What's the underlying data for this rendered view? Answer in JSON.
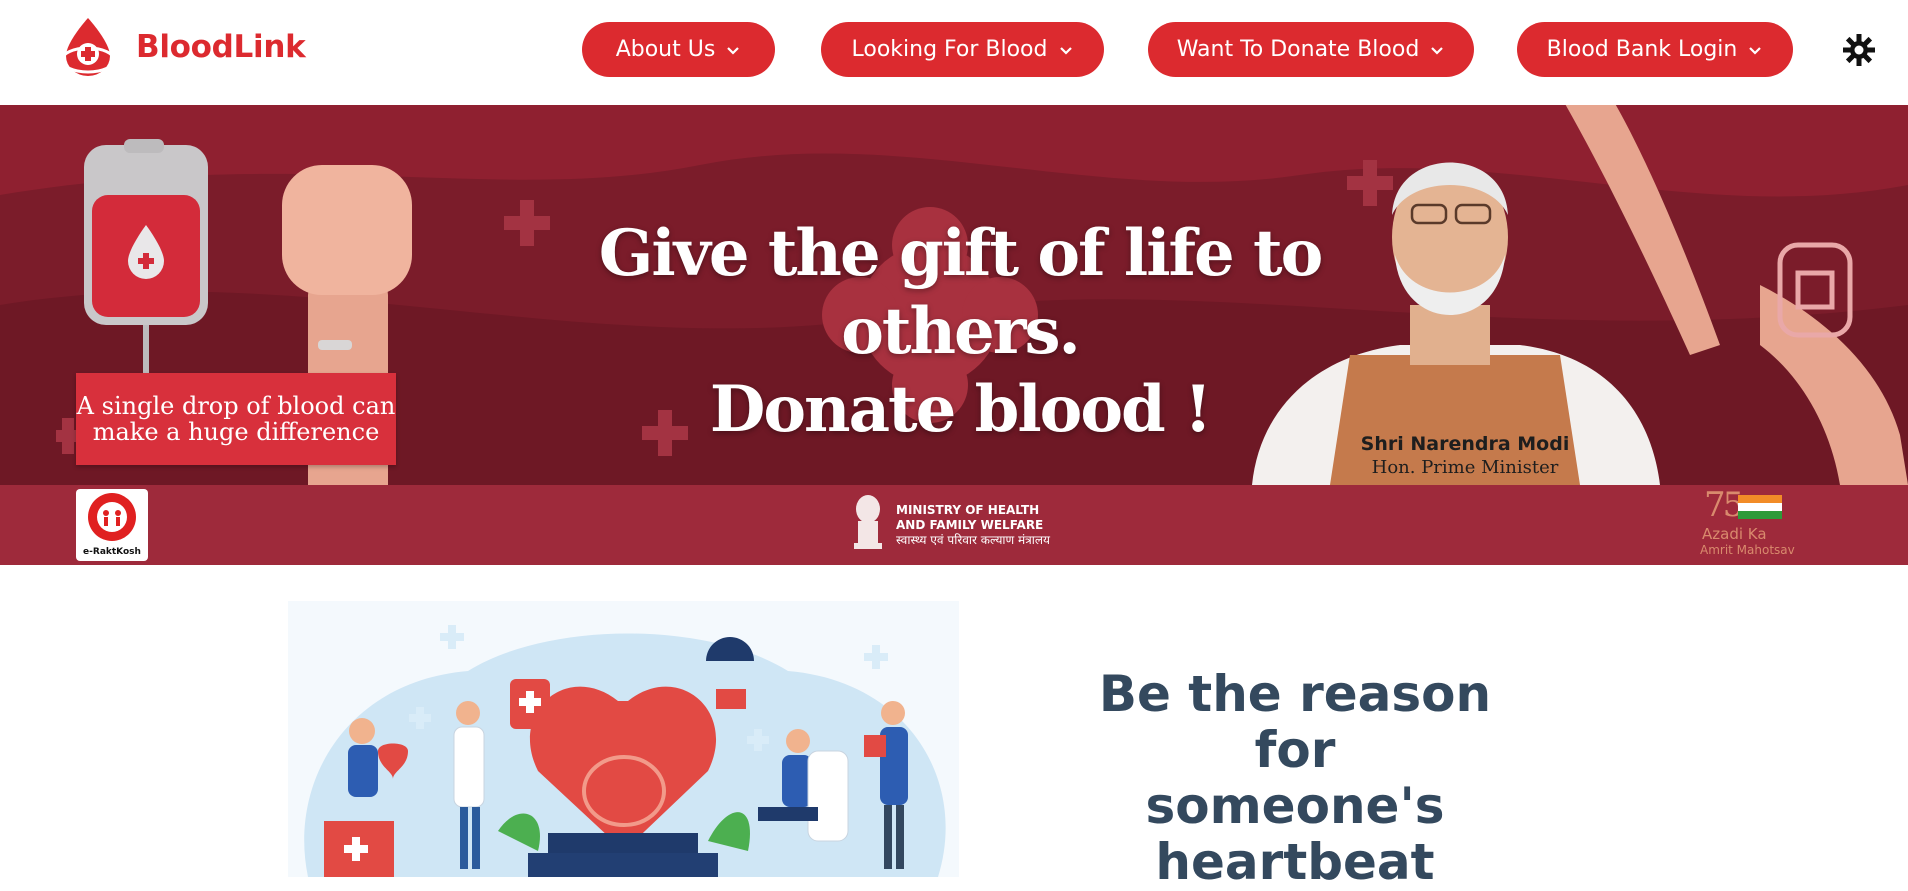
{
  "brand": {
    "name": "BloodLink",
    "color": "#dc2a2f"
  },
  "nav": {
    "items": [
      {
        "label": "About Us"
      },
      {
        "label": "Looking For Blood"
      },
      {
        "label": "Want To Donate Blood"
      },
      {
        "label": "Blood Bank Login"
      }
    ],
    "theme_icon": "gear-icon"
  },
  "banner": {
    "headline_line1": "Give the gift of life to others.",
    "headline_line2": "Donate blood !",
    "tagline_line1": "A single drop of blood can",
    "tagline_line2": "make a huge difference",
    "person_name": "Shri Narendra Modi",
    "person_title": "Hon. Prime Minister",
    "nhm_text": "e-RaktKosh",
    "ministry_line1": "MINISTRY OF HEALTH",
    "ministry_line2": "AND FAMILY WELFARE",
    "ministry_hindi": "स्वास्थ्य एवं परिवार कल्याण मंत्रालय",
    "azadi_number": "75",
    "azadi_line1": "Azadi Ka",
    "azadi_line2": "Amrit Mahotsav",
    "colors": {
      "dark": "#7b1c2a",
      "strip": "#9e2a3b",
      "accent": "#d8303c"
    }
  },
  "section": {
    "heading_line1": "Be the reason",
    "heading_line2": "for",
    "heading_line3": "someone's heartbeat",
    "heading_color": "#34495e"
  }
}
